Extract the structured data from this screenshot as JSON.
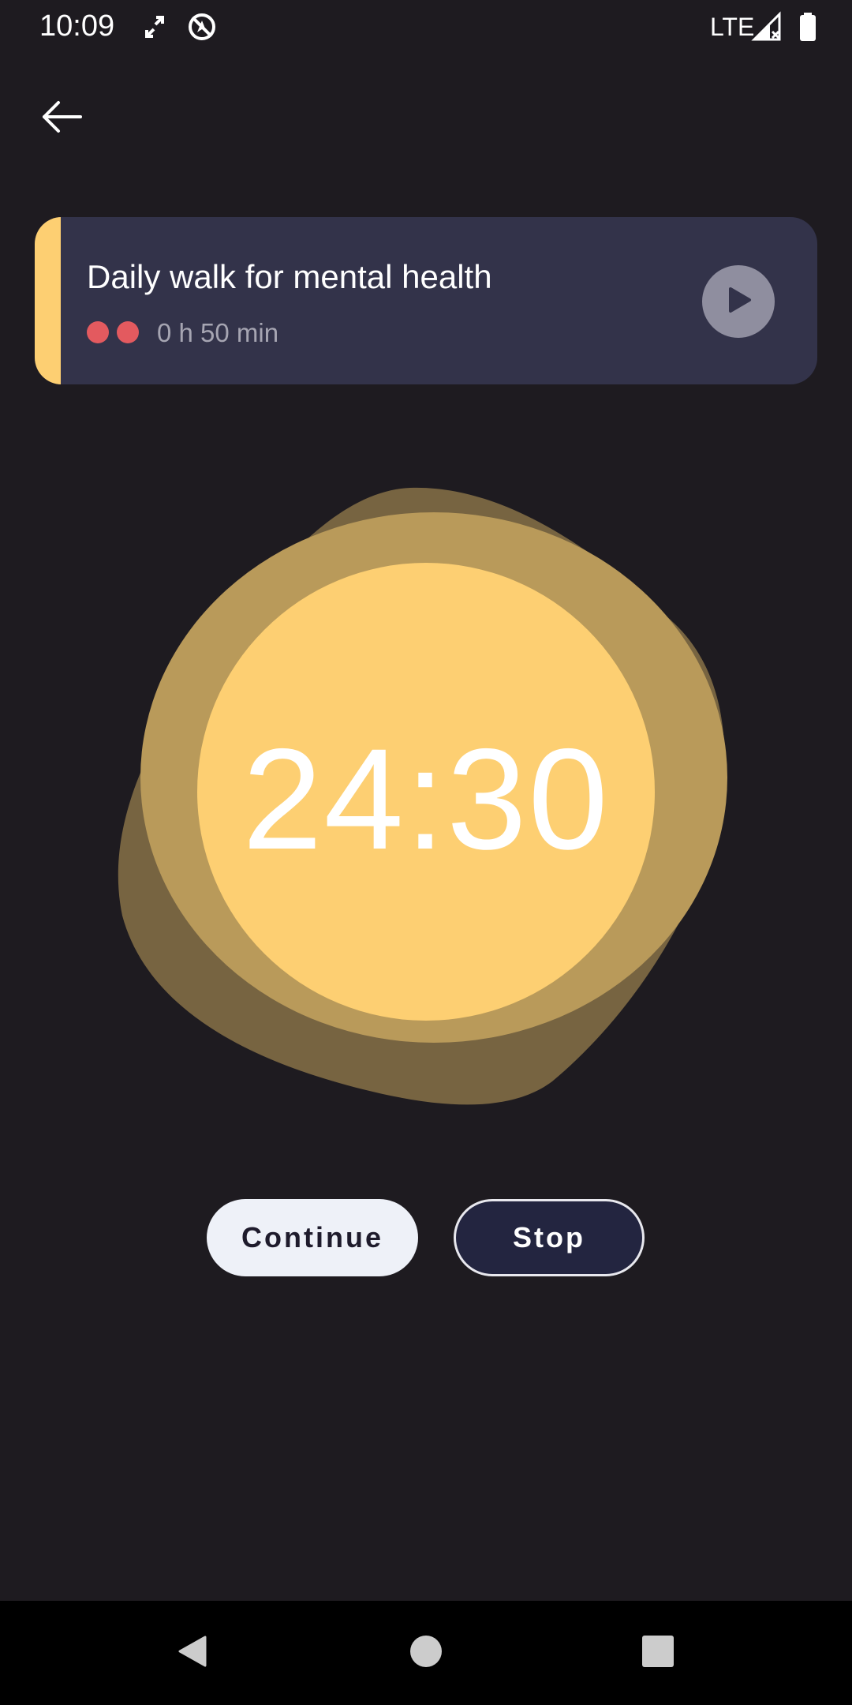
{
  "status_bar": {
    "time": "10:09",
    "network": "LTE",
    "icons": [
      "sync-arrows-icon",
      "no-location-icon",
      "signal-icon",
      "battery-icon"
    ]
  },
  "header": {
    "back_icon": "back-arrow-icon"
  },
  "activity": {
    "title": "Daily walk for mental health",
    "duration": "0 h 50 min",
    "difficulty_dots": 2,
    "play_icon": "play-icon",
    "colors": {
      "accent": "#fdcf72",
      "card": "#33334a",
      "dot": "#e35a5f"
    }
  },
  "timer": {
    "remaining": "24:30",
    "colors": {
      "outer_blob": "#776441",
      "middle_ring": "#b99a5a",
      "inner_circle": "#fdcf72"
    }
  },
  "actions": {
    "continue_label": "Continue",
    "stop_label": "Stop"
  },
  "nav_bar": {
    "back_icon": "nav-back-icon",
    "home_icon": "nav-home-icon",
    "recents_icon": "nav-recents-icon"
  }
}
